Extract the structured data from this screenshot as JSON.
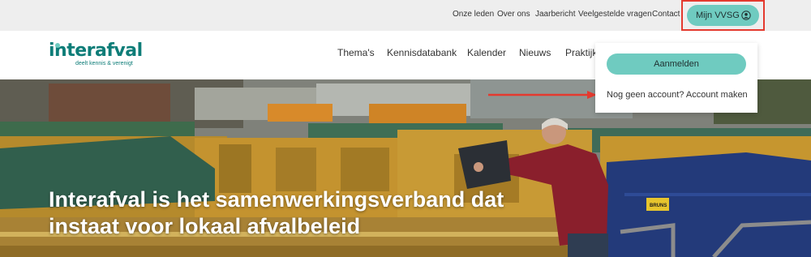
{
  "topbar": {
    "links": [
      "Onze leden",
      "Over ons",
      "Jaarbericht",
      "Veelgestelde vragen",
      "Contact"
    ],
    "account_button": "Mijn VVSG"
  },
  "logo": {
    "name": "interafval",
    "tagline": "deelt kennis & verenigt"
  },
  "nav": {
    "items": [
      "Thema's",
      "Kennisdatabank",
      "Kalender",
      "Nieuws",
      "Praktijk"
    ]
  },
  "hero": {
    "title": "Interafval is het samenwerkingsverband dat instaat voor lokaal afvalbeleid",
    "bin_label": "BRUNS"
  },
  "dropdown": {
    "login_button": "Aanmelden",
    "account_link": "Nog geen account? Account maken"
  },
  "colors": {
    "accent": "#6fcbc0",
    "brand": "#0e7d78",
    "highlight": "#e43a2f"
  }
}
